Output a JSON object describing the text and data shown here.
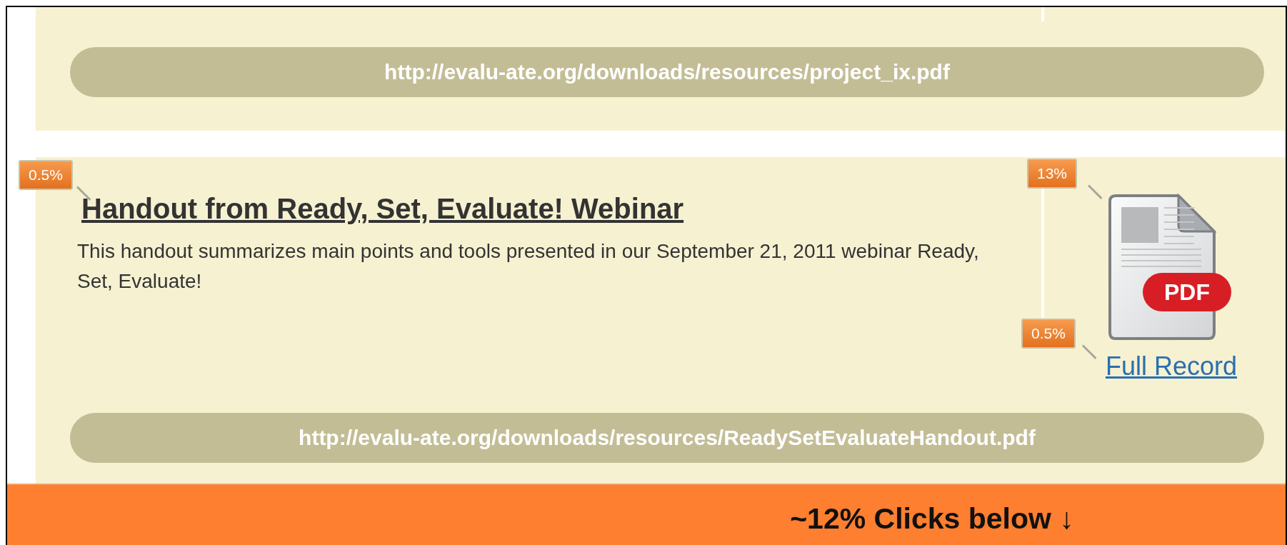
{
  "records": [
    {
      "url": "http://evalu-ate.org/downloads/resources/project_ix.pdf"
    },
    {
      "title_badge": "0.5%",
      "title": "Handout from Ready, Set, Evaluate! Webinar",
      "description": "This handout summarizes main points and tools presented in our September 21, 2011 webinar Ready, Set, Evaluate!",
      "icon_badge": "13%",
      "icon_label": "PDF",
      "link_badge": "0.5%",
      "link": "Full Record",
      "url": "http://evalu-ate.org/downloads/resources/ReadySetEvaluateHandout.pdf"
    }
  ],
  "click_banner": "~12% Clicks below ↓"
}
